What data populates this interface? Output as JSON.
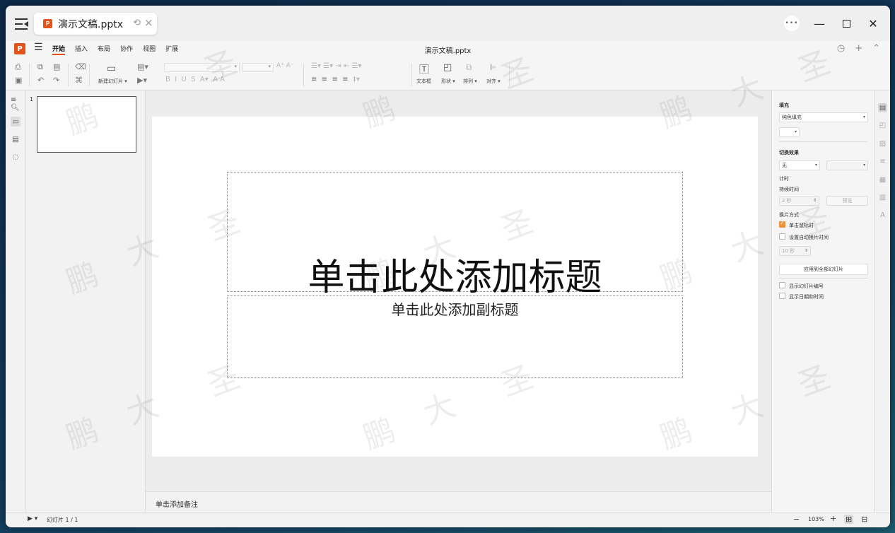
{
  "window": {
    "tab_title": "演示文稿.pptx",
    "doc_title": "演示文稿.pptx",
    "app_letter": "P",
    "brand_color": "#e2541c"
  },
  "menu": {
    "items": [
      "开始",
      "插入",
      "布局",
      "协作",
      "视图",
      "扩展"
    ],
    "active": "开始"
  },
  "toolbar": {
    "new_slide_label": "新建幻灯片",
    "textbox_label": "文本框",
    "shape_label": "形状",
    "arrange_label": "排列",
    "align_label": "对齐"
  },
  "thumbnails": [
    {
      "number": "1"
    }
  ],
  "slide": {
    "title_placeholder": "单击此处添加标题",
    "subtitle_placeholder": "单击此处添加副标题"
  },
  "notes": {
    "placeholder": "单击添加备注"
  },
  "props": {
    "fill_label": "填充",
    "fill_value": "纯色填充",
    "transition_label": "切换效果",
    "transition_value": "无",
    "timing_label": "计时",
    "duration_label": "持续时间",
    "duration_value": "2 秒",
    "preview_button": "预览",
    "advance_label": "换片方式",
    "on_click_label": "单击鼠标时",
    "on_click_checked": true,
    "auto_advance_label": "设置自动换片时间",
    "auto_advance_checked": false,
    "auto_time_value": "10 秒",
    "apply_all_button": "应用到全部幻灯片",
    "show_number_label": "显示幻灯片编号",
    "show_datetime_label": "显示日期和时间",
    "accent_color": "#f0923a"
  },
  "status": {
    "slide_counter": "幻灯片 1 / 1",
    "zoom": "103%"
  },
  "watermark": {
    "chars": [
      "鹏",
      "大",
      "圣"
    ]
  }
}
